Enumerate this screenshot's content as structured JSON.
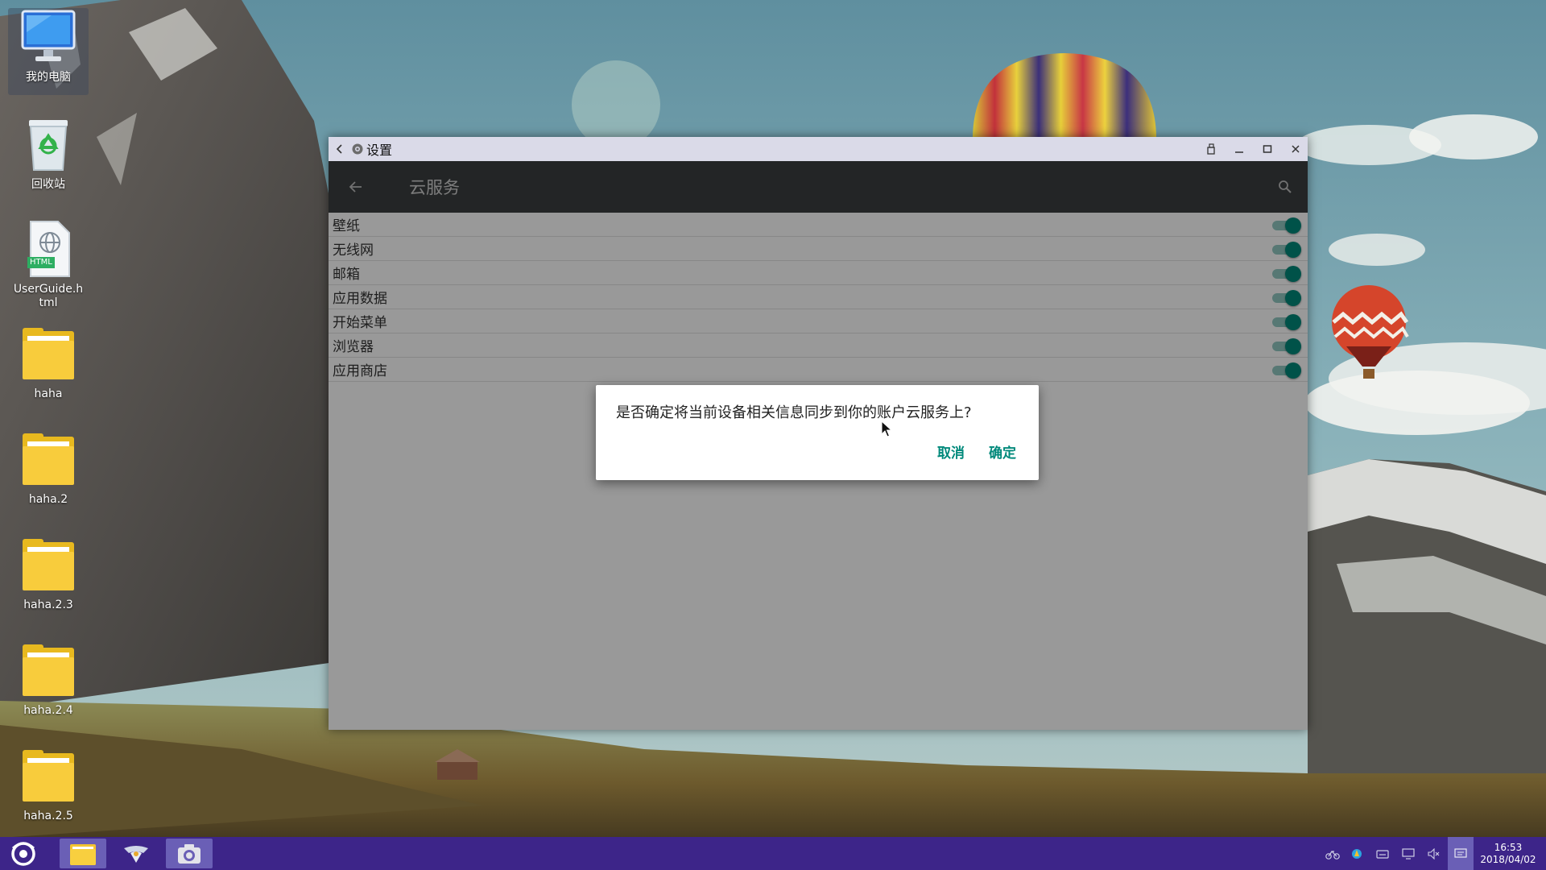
{
  "desktop": {
    "icons": [
      {
        "label": "我的电脑",
        "icon": "computer-icon"
      },
      {
        "label": "回收站",
        "icon": "recycle-bin-icon"
      },
      {
        "label": "UserGuide.h tml",
        "icon": "html-file-icon",
        "badge": "HTML"
      },
      {
        "label": "haha",
        "icon": "folder-icon"
      },
      {
        "label": "haha.2",
        "icon": "folder-icon"
      },
      {
        "label": "haha.2.3",
        "icon": "folder-icon"
      },
      {
        "label": "haha.2.4",
        "icon": "folder-icon"
      },
      {
        "label": "haha.2.5",
        "icon": "folder-icon"
      }
    ]
  },
  "window": {
    "title": "设置",
    "app_title": "云服务",
    "items": [
      {
        "label": "壁纸",
        "enabled": true
      },
      {
        "label": "无线网",
        "enabled": true
      },
      {
        "label": "邮箱",
        "enabled": true
      },
      {
        "label": "应用数据",
        "enabled": true
      },
      {
        "label": "开始菜单",
        "enabled": true
      },
      {
        "label": "浏览器",
        "enabled": true
      },
      {
        "label": "应用商店",
        "enabled": true
      }
    ]
  },
  "dialog": {
    "message": "是否确定将当前设备相关信息同步到你的账户云服务上?",
    "cancel_label": "取消",
    "confirm_label": "确定"
  },
  "taskbar": {
    "time": "16:53",
    "date": "2018/04/02"
  },
  "colors": {
    "accent": "#00897b",
    "taskbar": "#3d2589",
    "toolbar": "#3b3f40",
    "titlebar": "#dadae8"
  }
}
